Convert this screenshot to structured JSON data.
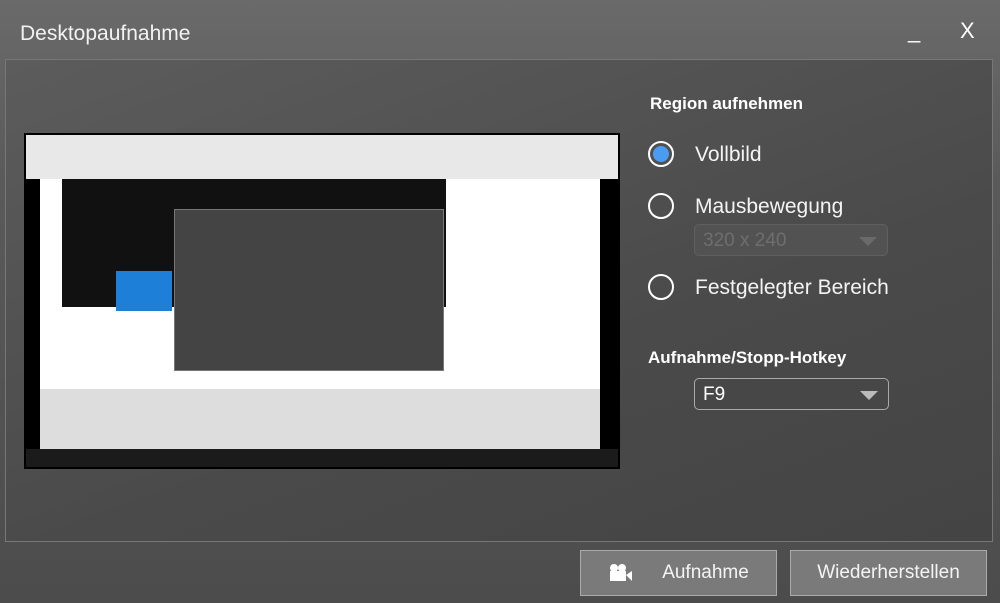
{
  "window": {
    "title": "Desktopaufnahme",
    "minimize": "_",
    "close": "X"
  },
  "region": {
    "heading": "Region aufnehmen",
    "options": [
      {
        "label": "Vollbild",
        "selected": true
      },
      {
        "label": "Mausbewegung",
        "selected": false
      },
      {
        "label": "Festgelegter Bereich",
        "selected": false
      }
    ],
    "size_value": "320 x 240"
  },
  "hotkey": {
    "heading": "Aufnahme/Stopp-Hotkey",
    "value": "F9"
  },
  "buttons": {
    "record": "Aufnahme",
    "restore": "Wiederherstellen"
  }
}
